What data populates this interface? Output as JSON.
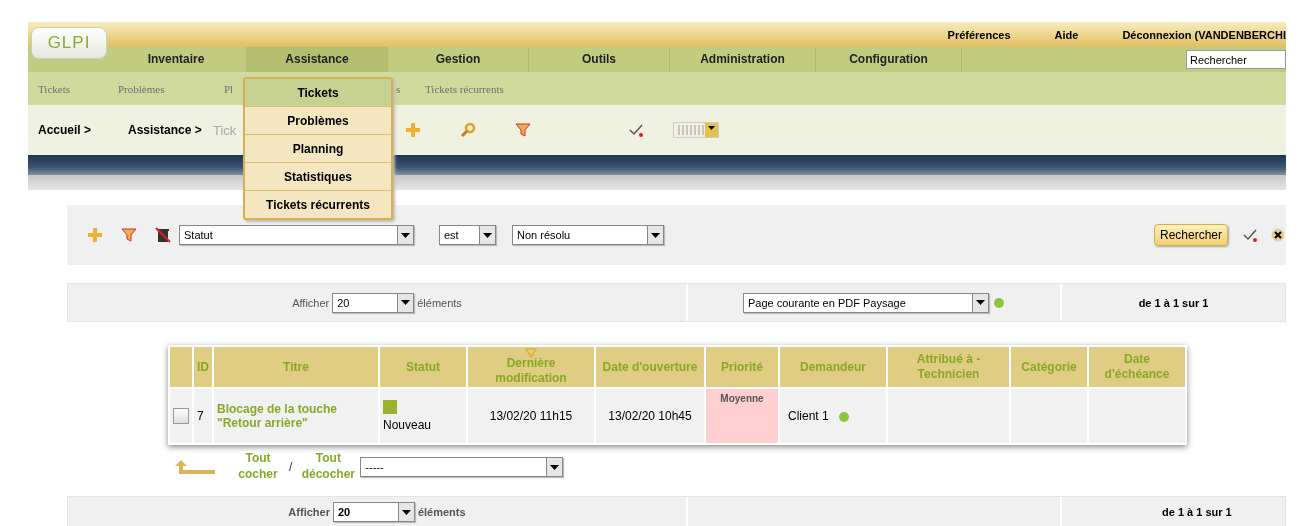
{
  "logo": "GLPI",
  "top_links": [
    "Préférences",
    "Aide",
    "Déconnexion (VANDENBERCHI"
  ],
  "main_menu": [
    {
      "label": "Inventaire",
      "selected": false
    },
    {
      "label": "Assistance",
      "selected": true
    },
    {
      "label": "Gestion",
      "selected": false
    },
    {
      "label": "Outils",
      "selected": false
    },
    {
      "label": "Administration",
      "selected": false
    },
    {
      "label": "Configuration",
      "selected": false
    }
  ],
  "search_field": {
    "value": "Rechercher"
  },
  "submenu": [
    "Tickets",
    "Problèmes",
    "Pl",
    "s",
    "Tickets récurrents"
  ],
  "breadcrumb": [
    "Accueil >",
    "Assistance >",
    "Tick"
  ],
  "dropdown": [
    {
      "label": "Tickets",
      "selected": true
    },
    {
      "label": "Problèmes",
      "selected": false
    },
    {
      "label": "Planning",
      "selected": false
    },
    {
      "label": "Statistiques",
      "selected": false
    },
    {
      "label": "Tickets récurrents",
      "selected": false
    }
  ],
  "search_panel": {
    "field": "Statut",
    "operator": "est",
    "value": "Non résolu",
    "button": "Rechercher"
  },
  "pager_top": {
    "label": "Afficher",
    "count": "20",
    "unit": "éléments",
    "export": "Page courante en PDF Paysage",
    "range": "de 1 à 1 sur 1"
  },
  "table": {
    "columns": [
      {
        "label": "ID",
        "sorted": false
      },
      {
        "label": "Titre",
        "sorted": false
      },
      {
        "label": "Statut",
        "sorted": false
      },
      {
        "label": "Dernière modification",
        "sorted": true
      },
      {
        "label": "Date d'ouverture",
        "sorted": false
      },
      {
        "label": "Priorité",
        "sorted": false
      },
      {
        "label": "Demandeur",
        "sorted": false
      },
      {
        "label": "Attribué à - Technicien",
        "sorted": false
      },
      {
        "label": "Catégorie",
        "sorted": false
      },
      {
        "label": "Date d'échéance",
        "sorted": false
      }
    ],
    "rows": [
      {
        "checked": false,
        "id": "7",
        "title": "Blocage de la touche \"Retour arrière\"",
        "status": "Nouveau",
        "last_modified": "13/02/20 11h15",
        "opened": "13/02/20 10h45",
        "priority": {
          "label": "Moyenne",
          "color": "#ffcfd2"
        },
        "requester": "Client 1"
      }
    ]
  },
  "mass_actions": {
    "check_all": "Tout cocher",
    "separator": "/",
    "uncheck_all": "Tout décocher",
    "action": "-----"
  },
  "pager_bottom": {
    "label": "Afficher",
    "count": "20",
    "unit": "éléments",
    "range": "de 1 à 1 sur 1"
  }
}
